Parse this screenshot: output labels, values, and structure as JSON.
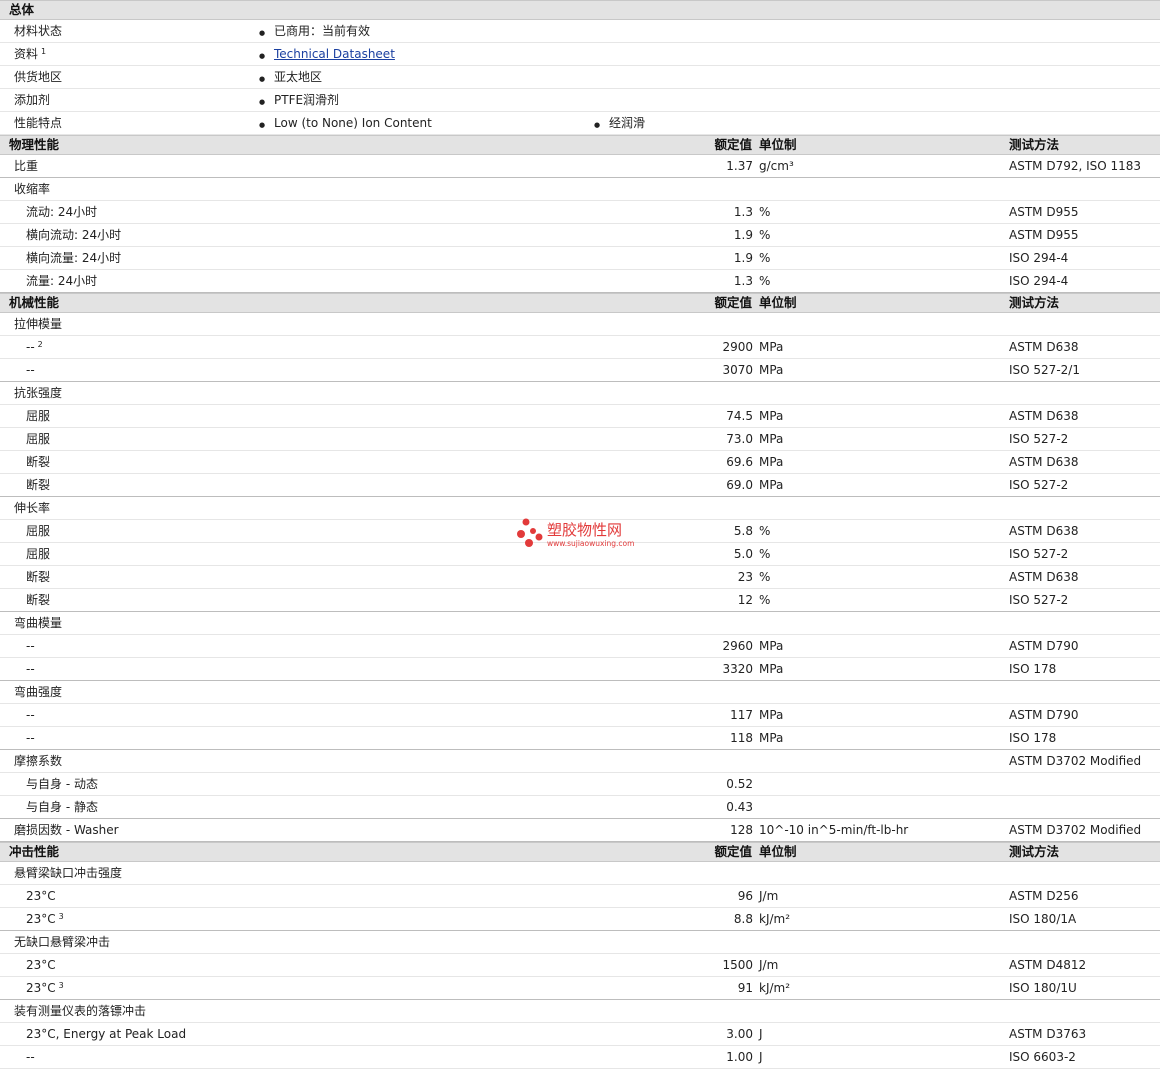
{
  "general": {
    "title": "总体",
    "rows": [
      {
        "label": "材料状态",
        "value": "已商用：当前有效"
      },
      {
        "label": "资料",
        "sup": "1",
        "value": "Technical Datasheet",
        "link": true
      },
      {
        "label": "供货地区",
        "value": "亚太地区"
      },
      {
        "label": "添加剂",
        "value": "PTFE润滑剂"
      },
      {
        "label": "性能特点",
        "value": "Low (to None) Ion Content",
        "value2": "经润滑"
      }
    ]
  },
  "headers": {
    "nominal": "额定值",
    "unit": "单位制",
    "method": "测试方法"
  },
  "sections": [
    {
      "title": "物理性能",
      "rows": [
        {
          "indent": 1,
          "label": "比重",
          "value": "1.37",
          "unit": "g/cm³",
          "method": "ASTM D792, ISO 1183",
          "end": true
        },
        {
          "indent": 1,
          "label": "收缩率",
          "value": "",
          "unit": "",
          "method": ""
        },
        {
          "indent": 2,
          "label": "流动: 24小时",
          "value": "1.3",
          "unit": "%",
          "method": "ASTM D955"
        },
        {
          "indent": 2,
          "label": "横向流动: 24小时",
          "value": "1.9",
          "unit": "%",
          "method": "ASTM D955"
        },
        {
          "indent": 2,
          "label": "横向流量: 24小时",
          "value": "1.9",
          "unit": "%",
          "method": "ISO 294-4"
        },
        {
          "indent": 2,
          "label": "流量: 24小时",
          "value": "1.3",
          "unit": "%",
          "method": "ISO 294-4",
          "end": true
        }
      ]
    },
    {
      "title": "机械性能",
      "rows": [
        {
          "indent": 1,
          "label": "拉伸模量",
          "value": "",
          "unit": "",
          "method": ""
        },
        {
          "indent": 2,
          "label": "--",
          "sup": "2",
          "value": "2900",
          "unit": "MPa",
          "method": "ASTM D638"
        },
        {
          "indent": 2,
          "label": "--",
          "value": "3070",
          "unit": "MPa",
          "method": "ISO 527-2/1",
          "end": true
        },
        {
          "indent": 1,
          "label": "抗张强度",
          "value": "",
          "unit": "",
          "method": ""
        },
        {
          "indent": 2,
          "label": "屈服",
          "value": "74.5",
          "unit": "MPa",
          "method": "ASTM D638"
        },
        {
          "indent": 2,
          "label": "屈服",
          "value": "73.0",
          "unit": "MPa",
          "method": "ISO 527-2"
        },
        {
          "indent": 2,
          "label": "断裂",
          "value": "69.6",
          "unit": "MPa",
          "method": "ASTM D638"
        },
        {
          "indent": 2,
          "label": "断裂",
          "value": "69.0",
          "unit": "MPa",
          "method": "ISO 527-2",
          "end": true
        },
        {
          "indent": 1,
          "label": "伸长率",
          "value": "",
          "unit": "",
          "method": ""
        },
        {
          "indent": 2,
          "label": "屈服",
          "value": "5.8",
          "unit": "%",
          "method": "ASTM D638"
        },
        {
          "indent": 2,
          "label": "屈服",
          "value": "5.0",
          "unit": "%",
          "method": "ISO 527-2"
        },
        {
          "indent": 2,
          "label": "断裂",
          "value": "23",
          "unit": "%",
          "method": "ASTM D638"
        },
        {
          "indent": 2,
          "label": "断裂",
          "value": "12",
          "unit": "%",
          "method": "ISO 527-2",
          "end": true
        },
        {
          "indent": 1,
          "label": "弯曲模量",
          "value": "",
          "unit": "",
          "method": ""
        },
        {
          "indent": 2,
          "label": "--",
          "value": "2960",
          "unit": "MPa",
          "method": "ASTM D790"
        },
        {
          "indent": 2,
          "label": "--",
          "value": "3320",
          "unit": "MPa",
          "method": "ISO 178",
          "end": true
        },
        {
          "indent": 1,
          "label": "弯曲强度",
          "value": "",
          "unit": "",
          "method": ""
        },
        {
          "indent": 2,
          "label": "--",
          "value": "117",
          "unit": "MPa",
          "method": "ASTM D790"
        },
        {
          "indent": 2,
          "label": "--",
          "value": "118",
          "unit": "MPa",
          "method": "ISO 178",
          "end": true
        },
        {
          "indent": 1,
          "label": "摩擦系数",
          "value": "",
          "unit": "",
          "method": "ASTM D3702 Modified"
        },
        {
          "indent": 2,
          "label": "与自身  - 动态",
          "value": "0.52",
          "unit": "",
          "method": ""
        },
        {
          "indent": 2,
          "label": "与自身  - 静态",
          "value": "0.43",
          "unit": "",
          "method": "",
          "end": true
        },
        {
          "indent": 1,
          "label": "磨损因数  - Washer",
          "value": "128",
          "unit": "10^-10 in^5-min/ft-lb-hr",
          "method": "ASTM D3702 Modified",
          "end": true
        }
      ]
    },
    {
      "title": "冲击性能",
      "rows": [
        {
          "indent": 1,
          "label": "悬臂梁缺口冲击强度",
          "value": "",
          "unit": "",
          "method": ""
        },
        {
          "indent": 2,
          "label": "23°C",
          "value": "96",
          "unit": "J/m",
          "method": "ASTM D256"
        },
        {
          "indent": 2,
          "label": "23°C",
          "sup": "3",
          "value": "8.8",
          "unit": "kJ/m²",
          "method": "ISO 180/1A",
          "end": true
        },
        {
          "indent": 1,
          "label": "无缺口悬臂梁冲击",
          "value": "",
          "unit": "",
          "method": ""
        },
        {
          "indent": 2,
          "label": "23°C",
          "value": "1500",
          "unit": "J/m",
          "method": "ASTM D4812"
        },
        {
          "indent": 2,
          "label": "23°C",
          "sup": "3",
          "value": "91",
          "unit": "kJ/m²",
          "method": "ISO 180/1U",
          "end": true
        },
        {
          "indent": 1,
          "label": "装有测量仪表的落镖冲击",
          "value": "",
          "unit": "",
          "method": ""
        },
        {
          "indent": 2,
          "label": "23°C, Energy at Peak Load",
          "value": "3.00",
          "unit": "J",
          "method": "ASTM D3763"
        },
        {
          "indent": 2,
          "label": "--",
          "value": "1.00",
          "unit": "J",
          "method": "ISO 6603-2"
        }
      ]
    }
  ],
  "watermark": {
    "text": "塑胶物性网",
    "url": "www.sujiaowuxing.com",
    "color": "#e23a3a"
  }
}
